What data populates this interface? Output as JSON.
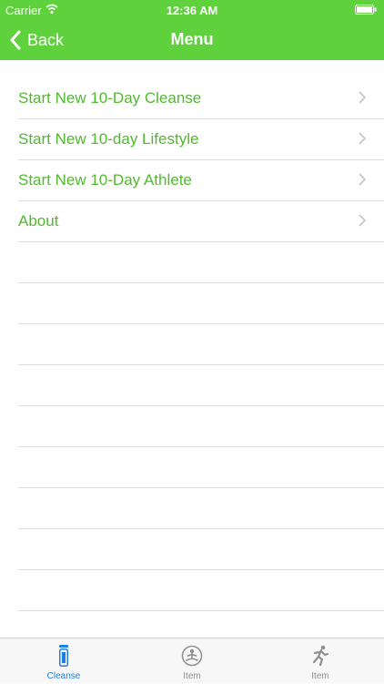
{
  "status_bar": {
    "carrier": "Carrier",
    "time": "12:36 AM"
  },
  "nav": {
    "back_label": "Back",
    "title": "Menu"
  },
  "menu": {
    "items": [
      {
        "label": "Start New 10-Day Cleanse"
      },
      {
        "label": "Start New 10-day Lifestyle"
      },
      {
        "label": "Start New 10-Day Athlete"
      },
      {
        "label": "About"
      }
    ]
  },
  "tabs": [
    {
      "label": "Cleanse",
      "icon": "bottle-icon"
    },
    {
      "label": "Item",
      "icon": "meditation-icon"
    },
    {
      "label": "Item",
      "icon": "runner-icon"
    }
  ],
  "colors": {
    "header": "#5ed13d",
    "menu_text": "#52b830",
    "tab_active": "#1e7fe0",
    "tab_inactive": "#8e8e93"
  }
}
